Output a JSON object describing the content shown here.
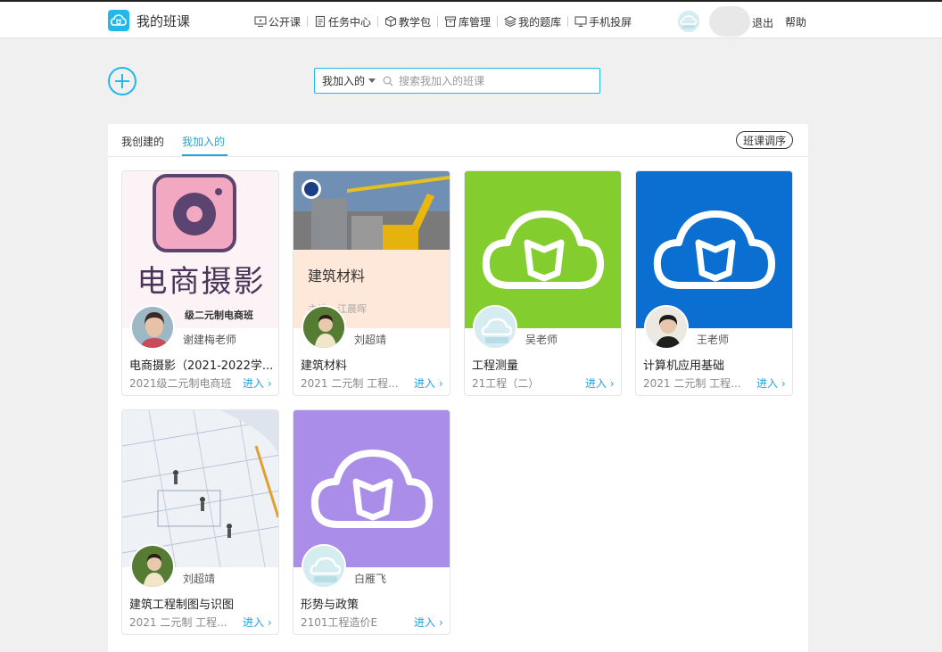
{
  "brand": {
    "title": "我的班课",
    "accent": "#21b8ea"
  },
  "nav": {
    "items": [
      {
        "label": "公开课",
        "icon": "monitor-play-icon"
      },
      {
        "label": "任务中心",
        "icon": "document-icon"
      },
      {
        "label": "教学包",
        "icon": "package-icon"
      },
      {
        "label": "库管理",
        "icon": "archive-icon"
      },
      {
        "label": "我的题库",
        "icon": "layers-icon"
      },
      {
        "label": "手机投屏",
        "icon": "screen-cast-icon"
      }
    ],
    "logout": "退出",
    "help": "帮助"
  },
  "search": {
    "filter": "我加入的",
    "placeholder": "搜索我加入的班课"
  },
  "tabs": {
    "created": "我创建的",
    "joined": "我加入的",
    "sort": "班课调序"
  },
  "enter_label": "进入",
  "courses": [
    {
      "teacher": "谢建梅老师",
      "title": "电商摄影（2021-2022学...",
      "class": "2021级二元制电商班",
      "cover": "photo-camera"
    },
    {
      "teacher": "刘超靖",
      "title": "建筑材料",
      "class": "2021 二元制 工程...",
      "cover": "construction"
    },
    {
      "teacher": "吴老师",
      "title": "工程测量",
      "class": "21工程（二）",
      "cover": "cloud-book-green"
    },
    {
      "teacher": "王老师",
      "title": "计算机应用基础",
      "class": "2021 二元制 工程...",
      "cover": "cloud-book-blue"
    },
    {
      "teacher": "刘超靖",
      "title": "建筑工程制图与识图",
      "class": "2021 二元制 工程...",
      "cover": "blueprint"
    },
    {
      "teacher": "白雁飞",
      "title": "形势与政策",
      "class": "2101工程造价E",
      "cover": "cloud-book-purple"
    }
  ],
  "covers": {
    "photo_text": "电商摄影",
    "photo_subtext": "级二元制电商班",
    "construction_text": "建筑材料",
    "construction_subtext": "主讲：江晨晖"
  },
  "colors": {
    "green": "#84cd2f",
    "blue": "#0a6fd1",
    "purple": "#aa8de8",
    "link": "#21a7d7"
  }
}
